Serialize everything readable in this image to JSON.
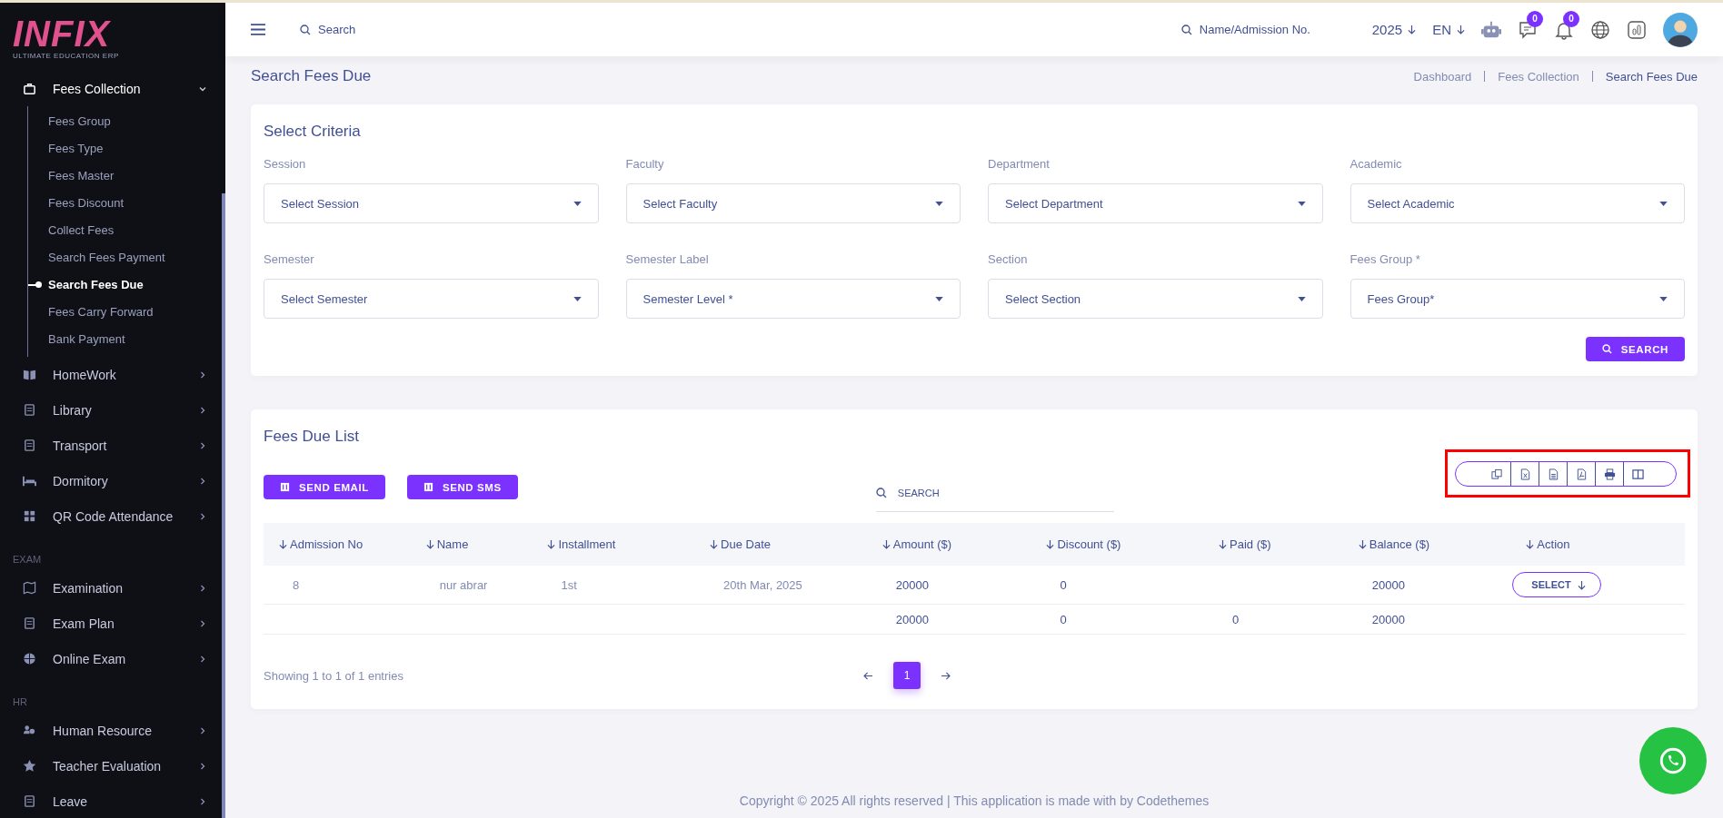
{
  "sidebar": {
    "logo": "INFIX",
    "tagline": "ULTIMATE EDUCATION ERP",
    "groups": [
      {
        "items": [
          {
            "label": "Fees Collection",
            "expanded": true,
            "children": [
              {
                "label": "Fees Group",
                "selected": false
              },
              {
                "label": "Fees Type",
                "selected": false
              },
              {
                "label": "Fees Master",
                "selected": false
              },
              {
                "label": "Fees Discount",
                "selected": false
              },
              {
                "label": "Collect Fees",
                "selected": false
              },
              {
                "label": "Search Fees Payment",
                "selected": false
              },
              {
                "label": "Search Fees Due",
                "selected": true
              },
              {
                "label": "Fees Carry Forward",
                "selected": false
              },
              {
                "label": "Bank Payment",
                "selected": false
              }
            ]
          },
          {
            "label": "HomeWork",
            "expanded": false
          },
          {
            "label": "Library",
            "expanded": false
          },
          {
            "label": "Transport",
            "expanded": false
          },
          {
            "label": "Dormitory",
            "expanded": false
          },
          {
            "label": "QR Code Attendance",
            "expanded": false
          }
        ]
      },
      {
        "heading": "EXAM",
        "items": [
          {
            "label": "Examination",
            "expanded": false
          },
          {
            "label": "Exam Plan",
            "expanded": false
          },
          {
            "label": "Online Exam",
            "expanded": false
          }
        ]
      },
      {
        "heading": "HR",
        "items": [
          {
            "label": "Human Resource",
            "expanded": false
          },
          {
            "label": "Teacher Evaluation",
            "expanded": false
          },
          {
            "label": "Leave",
            "expanded": false
          }
        ]
      }
    ]
  },
  "header": {
    "search": {
      "placeholder": "Search"
    },
    "student_search": {
      "placeholder": "Name/Admission No."
    },
    "year": "2025",
    "language": "EN",
    "chat_count": "0",
    "notification_count": "0"
  },
  "page": {
    "title": "Search Fees Due",
    "breadcrumb": [
      {
        "label": "Dashboard",
        "selected": false
      },
      {
        "label": "Fees Collection",
        "selected": false
      },
      {
        "label": "Search Fees Due",
        "selected": true
      }
    ]
  },
  "criteria": {
    "title": "Select Criteria",
    "fields": [
      {
        "label": "Session",
        "placeholder": "Select Session"
      },
      {
        "label": "Faculty",
        "placeholder": "Select Faculty"
      },
      {
        "label": "Department",
        "placeholder": "Select Department"
      },
      {
        "label": "Academic",
        "placeholder": "Select Academic"
      },
      {
        "label": "Semester",
        "placeholder": "Select Semester"
      },
      {
        "label": "Semester Label",
        "placeholder": "Semester Level *"
      },
      {
        "label": "Section",
        "placeholder": "Select Section"
      },
      {
        "label": "Fees Group *",
        "placeholder": "Fees Group*"
      }
    ],
    "button": "SEARCH"
  },
  "list": {
    "title": "Fees Due List",
    "buttons": [
      "SEND EMAIL",
      "SEND SMS"
    ],
    "search": {
      "placeholder": "SEARCH"
    },
    "columns": [
      "Admission No",
      "Name",
      "Installment",
      "Due Date",
      "Amount ($)",
      "Discount ($)",
      "Paid ($)",
      "Balance ($)",
      "Action"
    ],
    "rows": [
      {
        "admission_no": "8",
        "name": "nur abrar",
        "installment": "1st",
        "due_date": "20th Mar, 2025",
        "amount": "20000",
        "discount": "0",
        "balance": "20000",
        "action": "SELECT"
      }
    ],
    "totals": {
      "amount": "20000",
      "discount": "0",
      "paid": "0",
      "balance": "20000"
    },
    "info": "Showing 1 to 1 of 1 entries",
    "pages": [
      {
        "label": "1",
        "selected": true
      }
    ]
  },
  "footer": "Copyright © 2025 All rights reserved | This application is made with by Codethemes"
}
